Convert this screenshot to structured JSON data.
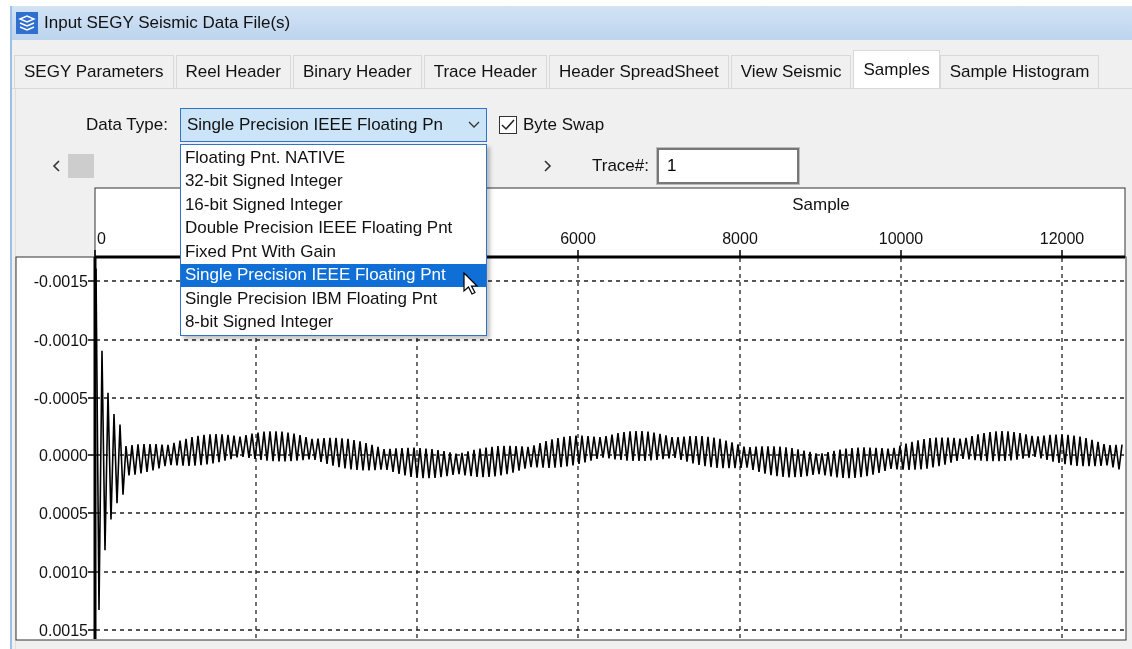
{
  "window": {
    "title": "Input SEGY Seismic Data File(s)"
  },
  "tabs": [
    {
      "label": "SEGY Parameters",
      "selected": false
    },
    {
      "label": "Reel Header",
      "selected": false
    },
    {
      "label": "Binary Header",
      "selected": false
    },
    {
      "label": "Trace Header",
      "selected": false
    },
    {
      "label": "Header SpreadSheet",
      "selected": false
    },
    {
      "label": "View Seismic",
      "selected": false
    },
    {
      "label": "Samples",
      "selected": true
    },
    {
      "label": "Sample Histogram",
      "selected": false
    }
  ],
  "data_type": {
    "label": "Data Type:",
    "value": "Single Precision IEEE Floating Pn",
    "expanded": true,
    "options": [
      {
        "label": "Floating Pnt. NATIVE",
        "selected": false
      },
      {
        "label": "32-bit Signed Integer",
        "selected": false
      },
      {
        "label": "16-bit Signed Integer",
        "selected": false
      },
      {
        "label": "Double Precision IEEE Floating Pnt",
        "selected": false
      },
      {
        "label": "Fixed Pnt With Gain",
        "selected": false
      },
      {
        "label": "Single Precision IEEE Floating Pnt",
        "selected": true
      },
      {
        "label": "Single Precision IBM Floating Pnt",
        "selected": false
      },
      {
        "label": "8-bit Signed Integer",
        "selected": false
      }
    ]
  },
  "byte_swap": {
    "label": "Byte Swap",
    "checked": true
  },
  "trace": {
    "label": "Trace#:",
    "value": "1"
  },
  "plot": {
    "xlabel": "Sample",
    "xticks": [
      "0",
      "6000",
      "8000",
      "10000",
      "12000"
    ],
    "yticks": [
      "-0.0015",
      "-0.0010",
      "-0.0005",
      "0.0000",
      "0.0005",
      "0.0010",
      "0.0015"
    ]
  }
}
